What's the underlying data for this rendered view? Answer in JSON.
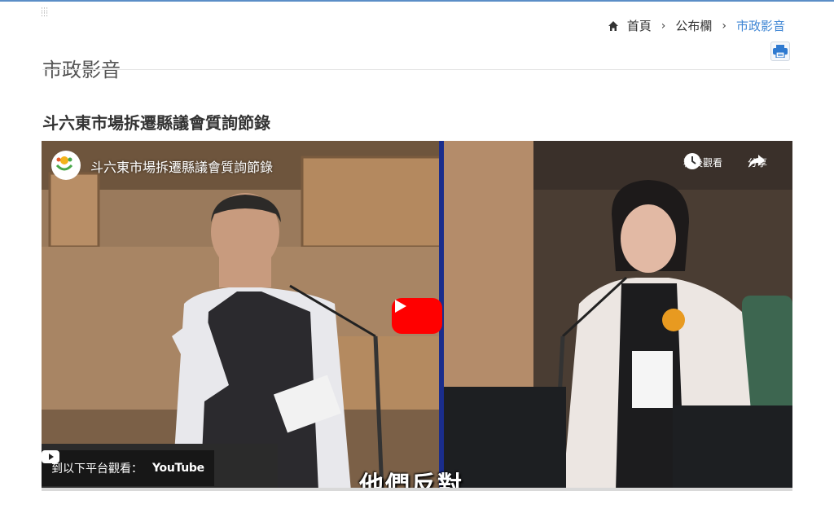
{
  "breadcrumb": {
    "items": [
      "首頁",
      "公布欄",
      "市政影音"
    ],
    "separator": "›",
    "current_color": "#3f86d4"
  },
  "header": {
    "title": "市政影音",
    "accent_color": "#5b8ec7"
  },
  "article": {
    "title": "斗六東市場拆遷縣議會質詢節錄"
  },
  "video": {
    "title": "斗六東市場拆遷縣議會質詢節錄",
    "watch_later_label": "稍後觀看",
    "share_label": "分享",
    "watch_on_label": "到以下平台觀看：",
    "youtube_label": "YouTube",
    "caption": "他們反對",
    "play_color": "#ff0000"
  }
}
